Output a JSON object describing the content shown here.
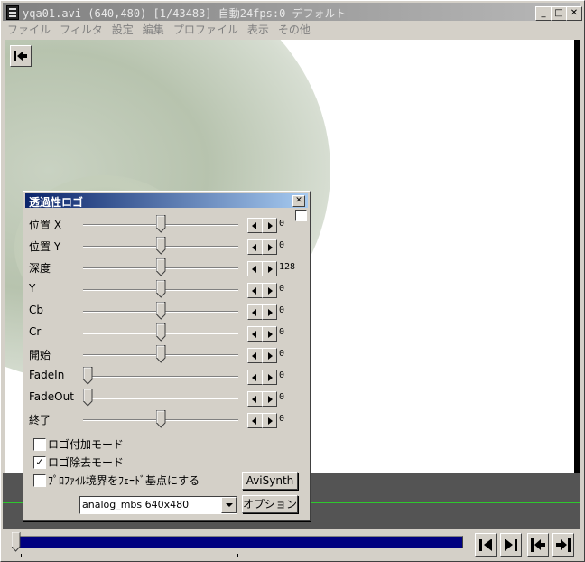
{
  "window": {
    "title": "yqa01.avi (640,480)  [1/43483]  自動24fps:0  デフォルト",
    "minimize": "_",
    "maximize": "□",
    "close": "✕"
  },
  "menu": [
    "ファイル",
    "フィルタ",
    "設定",
    "編集",
    "プロファイル",
    "表示",
    "その他"
  ],
  "dialog": {
    "title": "透過性ロゴ",
    "close": "✕",
    "sliders": [
      {
        "label": "位置 X",
        "value": "0",
        "level": 0.5
      },
      {
        "label": "位置 Y",
        "value": "0",
        "level": 0.5
      },
      {
        "label": "深度",
        "value": "128",
        "level": 0.5
      },
      {
        "label": "Y",
        "value": "0",
        "level": 0.5
      },
      {
        "label": "Cb",
        "value": "0",
        "level": 0.5
      },
      {
        "label": "Cr",
        "value": "0",
        "level": 0.5
      },
      {
        "label": "開始",
        "value": "0",
        "level": 0.5
      },
      {
        "label": "FadeIn",
        "value": "0",
        "level": 0
      },
      {
        "label": "FadeOut",
        "value": "0",
        "level": 0
      },
      {
        "label": "終了",
        "value": "0",
        "level": 0.5
      }
    ],
    "checkboxes": [
      {
        "label": "ロゴ付加モード",
        "checked": false
      },
      {
        "label": "ロゴ除去モード",
        "checked": true
      },
      {
        "label": "ﾌﾟﾛﾌｧｲﾙ境界をﾌｪｰﾄﾞ基点にする",
        "checked": false
      }
    ],
    "avisynth_button": "AviSynth",
    "option_button": "オプション",
    "logo_select": "analog_mbs 640x480"
  },
  "timeline": {
    "position": 0
  }
}
